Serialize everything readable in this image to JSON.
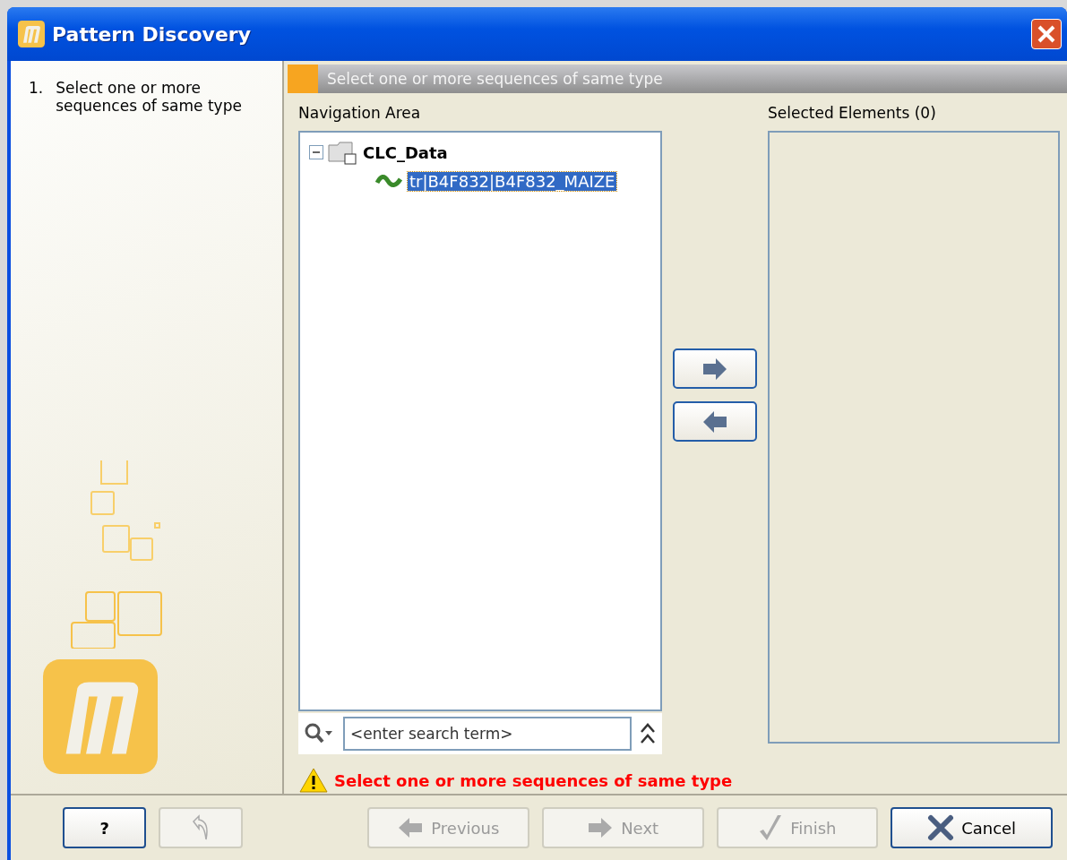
{
  "window": {
    "title": "Pattern Discovery"
  },
  "steps": [
    {
      "number": "1.",
      "label": "Select one or more sequences of same type",
      "selected": true
    }
  ],
  "header": {
    "title": "Select one or more sequences of same type"
  },
  "navigation": {
    "label": "Navigation Area",
    "tree": [
      {
        "label": "CLC_Data",
        "expanded": true,
        "selected": false,
        "children": [
          {
            "label": "tr|B4F832|B4F832_MAIZE",
            "selected": true
          }
        ]
      }
    ],
    "search": {
      "placeholder": "<enter search term>"
    }
  },
  "selected_elements": {
    "label": "Selected Elements (0)"
  },
  "warning": "Select one or more sequences of same type",
  "buttons": [
    {
      "kind": "help",
      "label": "?",
      "disabled": false
    },
    {
      "kind": "undo",
      "disabled": true
    },
    {
      "kind": "previous",
      "label": "Previous",
      "disabled": true
    },
    {
      "kind": "next",
      "label": "Next",
      "disabled": true
    },
    {
      "kind": "finish",
      "label": "Finish",
      "disabled": true
    },
    {
      "kind": "cancel",
      "label": "Cancel",
      "disabled": false
    }
  ]
}
